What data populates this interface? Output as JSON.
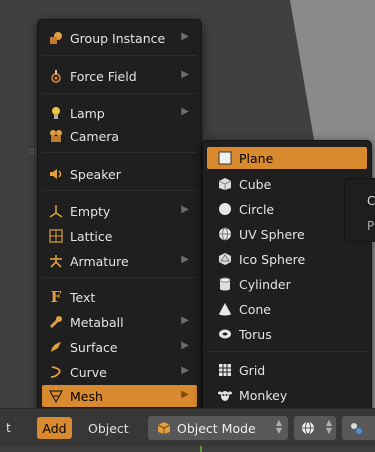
{
  "add_menu": {
    "items": [
      {
        "label": "Group Instance",
        "icon": "group-instance-icon",
        "submenu": true
      },
      {
        "label": "Force Field",
        "icon": "force-field-icon",
        "submenu": true
      },
      {
        "label": "Lamp",
        "icon": "lamp-icon",
        "submenu": true
      },
      {
        "label": "Camera",
        "icon": "camera-icon",
        "submenu": false
      },
      {
        "label": "Speaker",
        "icon": "speaker-icon",
        "submenu": false
      },
      {
        "label": "Empty",
        "icon": "empty-icon",
        "submenu": true
      },
      {
        "label": "Lattice",
        "icon": "lattice-icon",
        "submenu": false
      },
      {
        "label": "Armature",
        "icon": "armature-icon",
        "submenu": true
      },
      {
        "label": "Text",
        "icon": "text-icon",
        "submenu": false
      },
      {
        "label": "Metaball",
        "icon": "metaball-icon",
        "submenu": true
      },
      {
        "label": "Surface",
        "icon": "surface-icon",
        "submenu": true
      },
      {
        "label": "Curve",
        "icon": "curve-icon",
        "submenu": true
      },
      {
        "label": "Mesh",
        "icon": "mesh-icon",
        "submenu": true,
        "active": true
      }
    ]
  },
  "mesh_menu": {
    "items": [
      {
        "label": "Plane",
        "icon": "plane-icon",
        "active": true
      },
      {
        "label": "Cube",
        "icon": "cube-icon"
      },
      {
        "label": "Circle",
        "icon": "circle-icon"
      },
      {
        "label": "UV Sphere",
        "icon": "uv-sphere-icon"
      },
      {
        "label": "Ico Sphere",
        "icon": "ico-sphere-icon"
      },
      {
        "label": "Cylinder",
        "icon": "cylinder-icon"
      },
      {
        "label": "Cone",
        "icon": "cone-icon"
      },
      {
        "label": "Torus",
        "icon": "torus-icon"
      },
      {
        "label": "Grid",
        "icon": "grid-icon"
      },
      {
        "label": "Monkey",
        "icon": "monkey-icon"
      }
    ]
  },
  "tooltip": {
    "line1": "C",
    "line2": "P"
  },
  "header": {
    "truncated_label": "t",
    "add_label": "Add",
    "object_label": "Object",
    "mode_label": "Object Mode"
  },
  "colors": {
    "accent": "#d98a2e",
    "menu_bg": "#1f1f1f",
    "header_bg": "#373737"
  }
}
